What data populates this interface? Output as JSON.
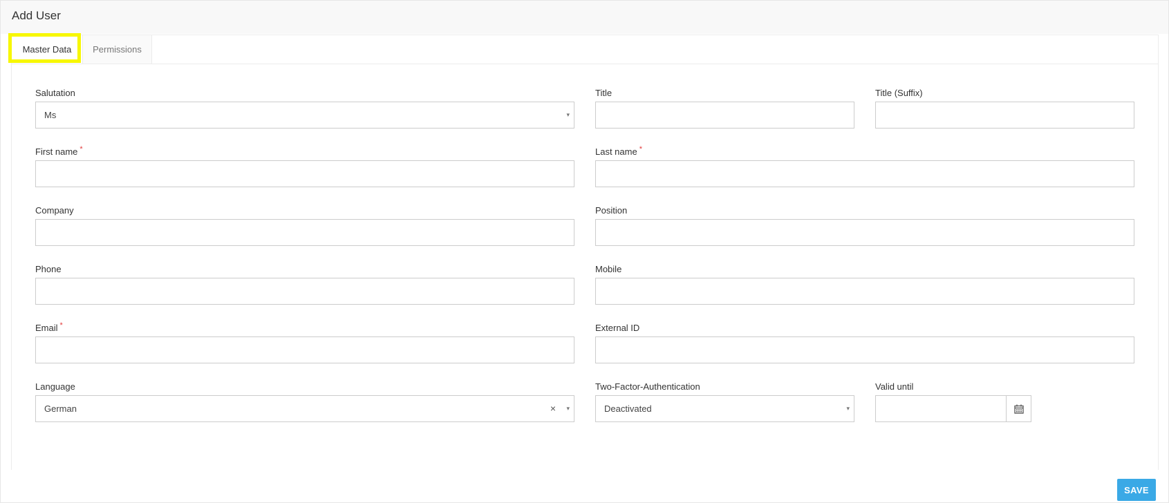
{
  "header": {
    "title": "Add User"
  },
  "tabs": [
    {
      "label": "Master Data"
    },
    {
      "label": "Permissions"
    }
  ],
  "form": {
    "salutation": {
      "label": "Salutation",
      "value": "Ms"
    },
    "title": {
      "label": "Title",
      "value": ""
    },
    "title_suffix": {
      "label": "Title (Suffix)",
      "value": ""
    },
    "first_name": {
      "label": "First name",
      "required_mark": "*",
      "value": ""
    },
    "last_name": {
      "label": "Last name",
      "required_mark": "*",
      "value": ""
    },
    "company": {
      "label": "Company",
      "value": ""
    },
    "position": {
      "label": "Position",
      "value": ""
    },
    "phone": {
      "label": "Phone",
      "value": ""
    },
    "mobile": {
      "label": "Mobile",
      "value": ""
    },
    "email": {
      "label": "Email",
      "required_mark": "*",
      "value": ""
    },
    "external_id": {
      "label": "External ID",
      "value": ""
    },
    "language": {
      "label": "Language",
      "value": "German",
      "clear_glyph": "×"
    },
    "two_factor": {
      "label": "Two-Factor-Authentication",
      "value": "Deactivated"
    },
    "valid_until": {
      "label": "Valid until",
      "value": ""
    },
    "caret_glyph": "▾"
  },
  "footer": {
    "save_label": "SAVE"
  },
  "colors": {
    "accent": "#3aa9e6",
    "highlight": "#f7f700",
    "required": "#e23b3b"
  },
  "icons": {
    "valid_until_button": "calendar-icon",
    "dropdown": "chevron-down-icon",
    "clear": "close-icon"
  }
}
